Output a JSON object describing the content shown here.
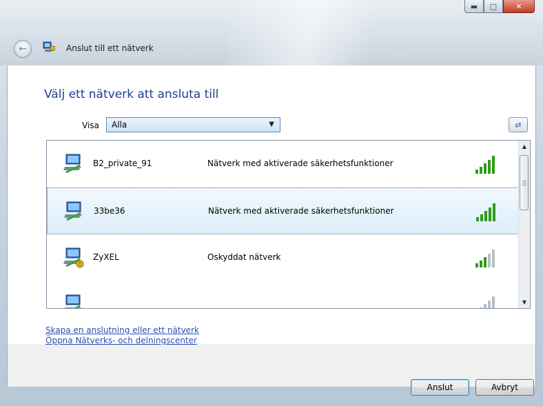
{
  "window": {
    "title": "Anslut till ett nätverk",
    "controls": {
      "minimize": "minimize-icon",
      "maximize": "maximize-icon",
      "close": "close-icon"
    }
  },
  "main": {
    "heading": "Välj ett nätverk att ansluta till",
    "filter": {
      "label": "Visa",
      "selected": "Alla"
    }
  },
  "networks": [
    {
      "name": "B2_private_91",
      "status": "Nätverk med aktiverade säkerhetsfunktioner",
      "secured": true,
      "signal_bars": 5,
      "selected": false
    },
    {
      "name": "33be36",
      "status": "Nätverk med aktiverade säkerhetsfunktioner",
      "secured": true,
      "signal_bars": 5,
      "selected": true
    },
    {
      "name": "ZyXEL",
      "status": "Oskyddat nätverk",
      "secured": false,
      "signal_bars": 3,
      "selected": false
    },
    {
      "name": "",
      "status": "",
      "secured": true,
      "signal_bars": 1,
      "selected": false
    }
  ],
  "links": {
    "create": "Skapa en anslutning eller ett nätverk",
    "center": "Öppna Nätverks- och delningscenter"
  },
  "buttons": {
    "connect": "Anslut",
    "cancel": "Avbryt"
  },
  "colors": {
    "heading": "#1e3f8f",
    "link": "#2a4fb1",
    "signal_active": "#2e9a1a",
    "signal_inactive": "#b9bec4"
  }
}
